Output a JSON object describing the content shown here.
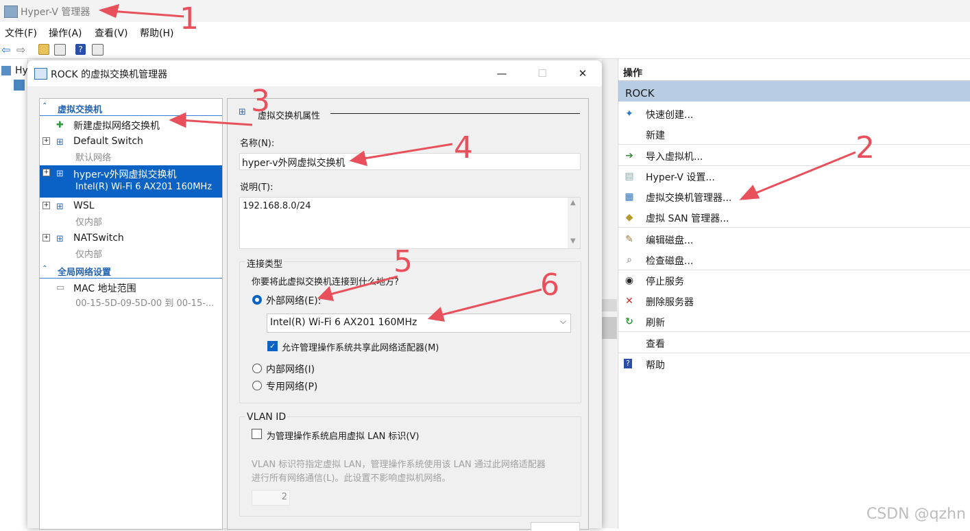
{
  "app": {
    "title": "Hyper-V 管理器",
    "tree_root_partial": "Hy"
  },
  "menu": [
    "文件(F)",
    "操作(A)",
    "查看(V)",
    "帮助(H)"
  ],
  "dialog": {
    "title": "ROCK 的虚拟交换机管理器",
    "window_buttons": {
      "minimize": "—",
      "maximize": "☐",
      "close": "✕"
    },
    "tree": {
      "group1": "虚拟交换机",
      "new_switch": "新建虚拟网络交换机",
      "switches": [
        {
          "name": "Default Switch",
          "sub": "默认网络"
        },
        {
          "name": "hyper-v外网虚拟交换机",
          "sub": "Intel(R) Wi-Fi 6 AX201 160MHz"
        },
        {
          "name": "WSL",
          "sub": "仅内部"
        },
        {
          "name": "NATSwitch",
          "sub": "仅内部"
        }
      ],
      "group2": "全局网络设置",
      "mac": {
        "name": "MAC 地址范围",
        "sub": "00-15-5D-09-5D-00 到 00-15-..."
      }
    },
    "props": {
      "section_title": "虚拟交换机属性",
      "name_label": "名称(N):",
      "name_value": "hyper-v外网虚拟交换机",
      "desc_label": "说明(T):",
      "desc_value": "192.168.8.0/24",
      "conn_group": "连接类型",
      "conn_question": "你要将此虚拟交换机连接到什么地方?",
      "external": "外部网络(E):",
      "adapter": "Intel(R) Wi-Fi 6 AX201 160MHz",
      "allow_share": "允许管理操作系统共享此网络适配器(M)",
      "internal": "内部网络(I)",
      "private": "专用网络(P)",
      "vlan_group": "VLAN ID",
      "vlan_enable": "为管理操作系统启用虚拟 LAN 标识(V)",
      "vlan_note_1": "VLAN 标识符指定虚拟 LAN，管理操作系统使用该 LAN 通过此网络适配器",
      "vlan_note_2": "进行所有网络通信(L)。此设置不影响虚拟机网络。",
      "vlan_value": "2"
    }
  },
  "actions": {
    "header": "操作",
    "section": "ROCK",
    "items": [
      {
        "label": "快速创建...",
        "icon": "quick-create-icon"
      },
      {
        "label": "新建",
        "icon": ""
      },
      {
        "label": "导入虚拟机...",
        "icon": "import-icon"
      },
      {
        "label": "Hyper-V 设置...",
        "icon": "settings-icon"
      },
      {
        "label": "虚拟交换机管理器...",
        "icon": "switch-manager-icon"
      },
      {
        "label": "虚拟 SAN 管理器...",
        "icon": "san-icon"
      },
      {
        "label": "编辑磁盘...",
        "icon": "edit-disk-icon"
      },
      {
        "label": "检查磁盘...",
        "icon": "inspect-disk-icon"
      },
      {
        "label": "停止服务",
        "icon": "stop-icon"
      },
      {
        "label": "删除服务器",
        "icon": "delete-icon"
      },
      {
        "label": "刷新",
        "icon": "refresh-icon"
      },
      {
        "label": "查看",
        "icon": ""
      },
      {
        "label": "帮助",
        "icon": "help-icon"
      }
    ]
  },
  "annotations": [
    "1",
    "2",
    "3",
    "4",
    "5",
    "6"
  ],
  "watermark": "CSDN @qzhn",
  "colors": {
    "selection": "#0a63c4",
    "section_bg": "#b8cde4",
    "annotation": "#e8505b",
    "group_text": "#2464b4"
  }
}
